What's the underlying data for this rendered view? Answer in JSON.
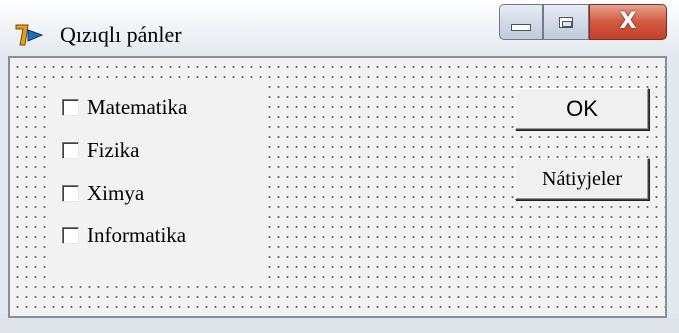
{
  "window": {
    "title": "Qızıqlı pánler",
    "icon": "delphi-app-icon",
    "controls": {
      "minimize_icon": "minimize-icon",
      "maximize_icon": "maximize-icon",
      "close_label": "X"
    }
  },
  "checklist": {
    "items": [
      {
        "label": "Matematika",
        "checked": false
      },
      {
        "label": "Fizika",
        "checked": false
      },
      {
        "label": "Ximya",
        "checked": false
      },
      {
        "label": "Informatika",
        "checked": false
      }
    ]
  },
  "buttons": {
    "ok_label": "OK",
    "results_label": "Nátiyjeler"
  },
  "colors": {
    "close_button": "#d15a3f",
    "form_background": "#f2f2f2"
  }
}
